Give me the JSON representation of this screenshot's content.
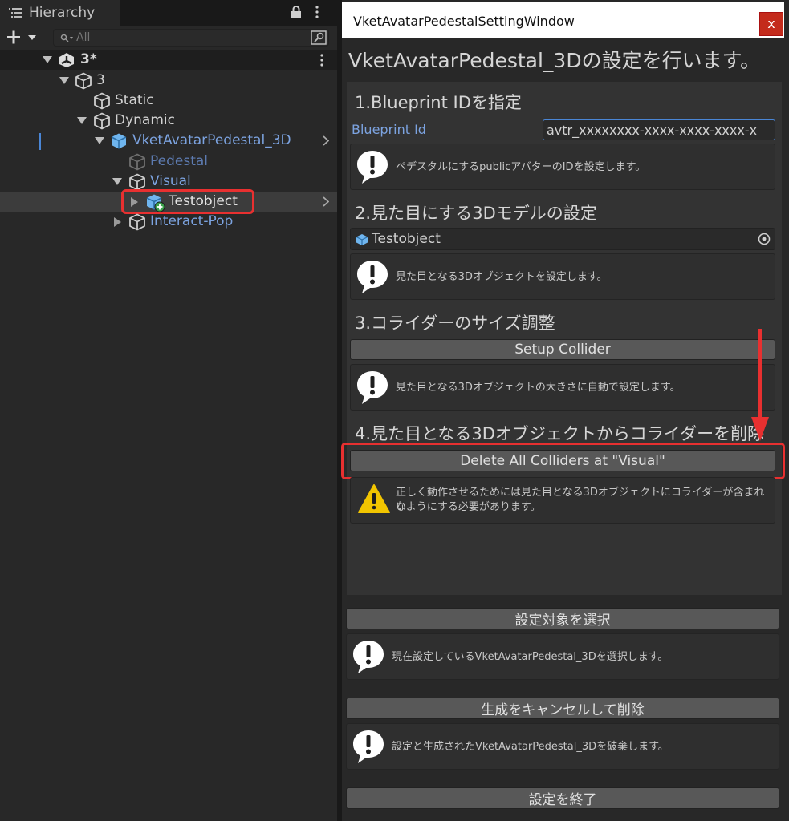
{
  "hierarchy": {
    "tab_title": "Hierarchy",
    "search_placeholder": "All",
    "rows": {
      "scene": "3*",
      "root": "3",
      "static": "Static",
      "dynamic": "Dynamic",
      "pedestal_root": "VketAvatarPedestal_3D",
      "pedestal": "Pedestal",
      "visual": "Visual",
      "testobject": "Testobject",
      "interact": "Interact-Pop"
    }
  },
  "window": {
    "title": "VketAvatarPedestalSettingWindow",
    "close_label": "x",
    "heading": "VketAvatarPedestal_3Dの設定を行います。",
    "section1": {
      "title": "1.Blueprint IDを指定",
      "field_label": "Blueprint Id",
      "field_value": "avtr_xxxxxxxx-xxxx-xxxx-xxxx-x",
      "help": "ペデスタルにするpublicアバターのIDを設定します。"
    },
    "section2": {
      "title": "2.見た目にする3Dモデルの設定",
      "field_value": "Testobject",
      "help": "見た目となる3Dオブジェクトを設定します。"
    },
    "section3": {
      "title": "3.コライダーのサイズ調整",
      "button": "Setup Collider",
      "help": "見た目となる3Dオブジェクトの大きさに自動で設定します。"
    },
    "section4": {
      "title": "4.見た目となる3Dオブジェクトからコライダーを削除",
      "button": "Delete All Colliders at \"Visual\"",
      "warning_line1": "正しく動作させるためには見た目となる3Dオブジェクトにコライダーが含まれな",
      "warning_line2": "いようにする必要があります。"
    },
    "select_button": "設定対象を選択",
    "select_help": "現在設定しているVketAvatarPedestal_3Dを選択します。",
    "cancel_button": "生成をキャンセルして削除",
    "cancel_help": "設定と生成されたVketAvatarPedestal_3Dを破棄します。",
    "finish_button": "設定を終了"
  },
  "colors": {
    "highlight_red": "#e83030",
    "link_blue": "#7ca3e0",
    "warning_yellow": "#f2c500"
  }
}
